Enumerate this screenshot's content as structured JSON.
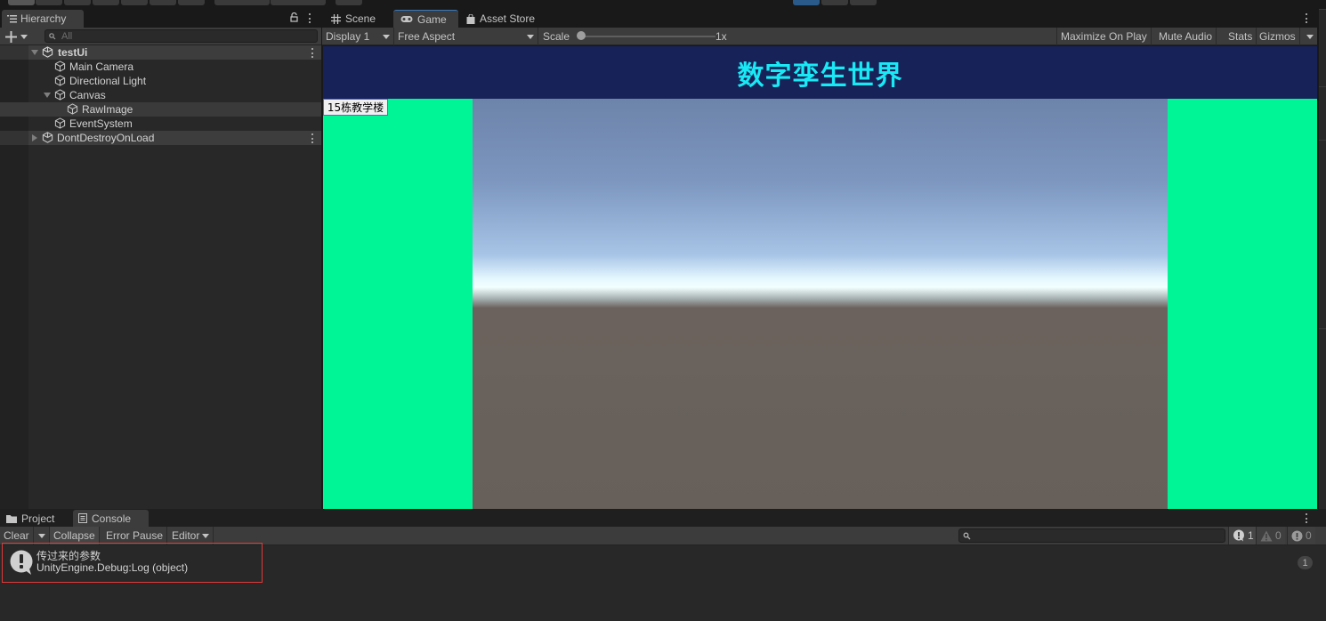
{
  "hierarchy": {
    "tab_label": "Hierarchy",
    "search_placeholder": "All",
    "rows": [
      {
        "label": "testUi",
        "type": "scene",
        "expanded": true
      },
      {
        "label": "Main Camera",
        "type": "gameobject"
      },
      {
        "label": "Directional Light",
        "type": "gameobject"
      },
      {
        "label": "Canvas",
        "type": "gameobject",
        "expanded": true
      },
      {
        "label": "RawImage",
        "type": "gameobject",
        "selected": true
      },
      {
        "label": "EventSystem",
        "type": "gameobject"
      },
      {
        "label": "DontDestroyOnLoad",
        "type": "scene",
        "expanded": false
      }
    ]
  },
  "game_panel": {
    "tabs": [
      {
        "label": "Scene",
        "icon": "grid-icon"
      },
      {
        "label": "Game",
        "icon": "gamepad-icon",
        "active": true
      },
      {
        "label": "Asset Store",
        "icon": "shopping-bag-icon"
      }
    ],
    "toolbar": {
      "display": "Display 1",
      "aspect": "Free Aspect",
      "scale_label": "Scale",
      "scale_value": "1x",
      "maximize_on_play": "Maximize On Play",
      "mute_audio": "Mute Audio",
      "stats": "Stats",
      "gizmos": "Gizmos"
    },
    "viewport": {
      "banner_title": "数字孪生世界",
      "building_button": "15栋教学楼",
      "colors": {
        "banner": "#172258",
        "title": "#19e8f5",
        "side_panels": "#00f596"
      }
    }
  },
  "console_panel": {
    "tabs": [
      {
        "label": "Project",
        "icon": "folder-icon"
      },
      {
        "label": "Console",
        "icon": "console-icon",
        "active": true
      }
    ],
    "toolbar": {
      "clear": "Clear",
      "collapse": "Collapse",
      "error_pause": "Error Pause",
      "editor": "Editor",
      "log_count": "1",
      "warning_count": "0",
      "error_count": "0"
    },
    "entries": [
      {
        "message": "传过来的参数",
        "stack": "UnityEngine.Debug:Log (object)",
        "count": "1"
      }
    ]
  }
}
